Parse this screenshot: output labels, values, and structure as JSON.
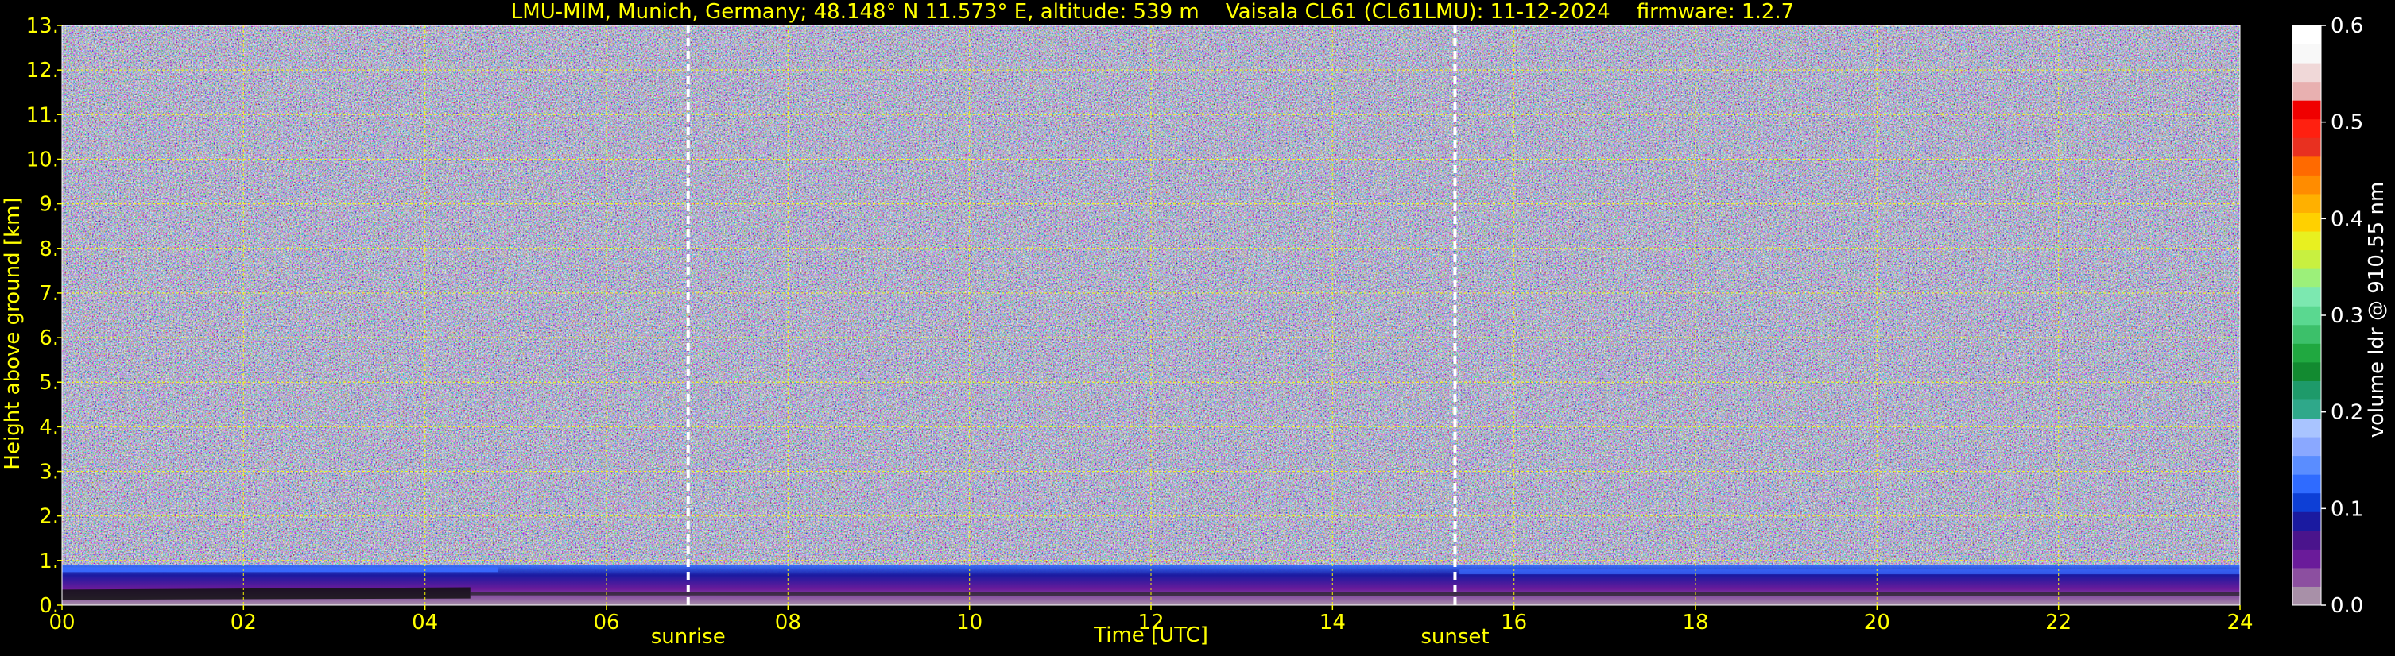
{
  "title": "LMU-MIM, Munich, Germany; 48.148° N 11.573° E, altitude: 539 m    Vaisala CL61 (CL61LMU): 11-12-2024    firmware: 1.2.7",
  "chart_data": {
    "type": "heatmap",
    "title": "LMU-MIM, Munich, Germany; 48.148° N 11.573° E, altitude: 539 m    Vaisala CL61 (CL61LMU): 11-12-2024    firmware: 1.2.7",
    "xlabel": "Time [UTC]",
    "ylabel": "Height above ground [km]",
    "xlim": [
      0,
      24
    ],
    "ylim": [
      0,
      13
    ],
    "x_ticks": [
      "00",
      "02",
      "04",
      "06",
      "08",
      "10",
      "12",
      "14",
      "16",
      "18",
      "20",
      "22",
      "24"
    ],
    "y_ticks": [
      "0.",
      "1.",
      "2.",
      "3.",
      "4.",
      "5.",
      "6.",
      "7.",
      "8.",
      "9.",
      "10.",
      "11.",
      "12.",
      "13."
    ],
    "grid": true,
    "markers": [
      {
        "label": "sunrise",
        "x": 6.9
      },
      {
        "label": "sunset",
        "x": 15.35
      }
    ],
    "colorbar": {
      "label": "volume ldr @ 910.55 nm",
      "range": [
        0.0,
        0.6
      ],
      "ticks": [
        "0.0",
        "0.1",
        "0.2",
        "0.3",
        "0.4",
        "0.5",
        "0.6"
      ],
      "colors": [
        "#a890a8",
        "#8c4fa0",
        "#6a1b9a",
        "#4a148c",
        "#1a1aa0",
        "#0d3fd6",
        "#2f6bff",
        "#5a8dff",
        "#8aa8ff",
        "#a9c4ff",
        "#2fa88a",
        "#1e9a6a",
        "#128a30",
        "#20a840",
        "#3cc06a",
        "#5ad890",
        "#7ce8b0",
        "#9cf07a",
        "#c8f040",
        "#e8f020",
        "#ffd000",
        "#ffb000",
        "#ff8c00",
        "#ff6a00",
        "#e83020",
        "#ff2010",
        "#f00000",
        "#e8b0b0",
        "#f0d8d8",
        "#f8f8f8",
        "#ffffff"
      ]
    },
    "data_regions": [
      {
        "label": "noise field (mixed ldr values)",
        "y_range": [
          1.0,
          13.0
        ]
      },
      {
        "label": "boundary layer, high ldr",
        "y_range": [
          0.0,
          0.9
        ]
      }
    ]
  }
}
